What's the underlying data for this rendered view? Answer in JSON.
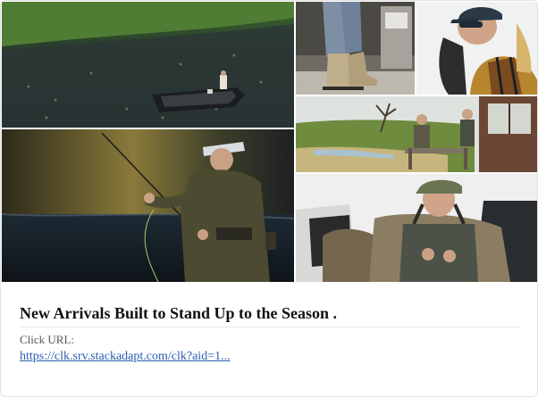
{
  "ad": {
    "title": "New Arrivals Built to Stand Up to the Season .",
    "click_url_label": "Click URL:",
    "click_url": "https://clk.srv.stackadapt.com/clk?aid=1..."
  },
  "images": [
    {
      "name": "aerial-river-boat-photo"
    },
    {
      "name": "fly-fishing-angler-photo"
    },
    {
      "name": "boots-and-jeans-photo"
    },
    {
      "name": "woman-sunglasses-cap-photo"
    },
    {
      "name": "riverbank-fence-photo"
    },
    {
      "name": "man-in-waders-truck-photo"
    }
  ],
  "colors": {
    "link": "#2a5db0",
    "title": "#111111"
  }
}
